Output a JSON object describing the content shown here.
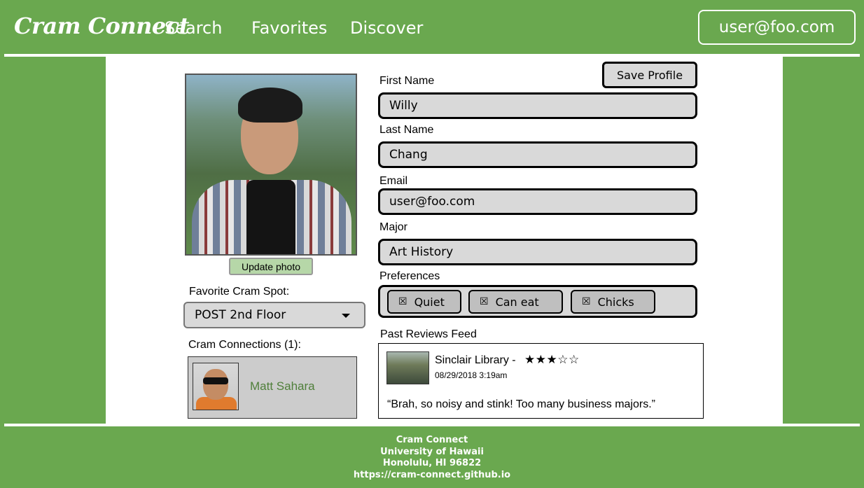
{
  "header": {
    "logo": "Cram Connect",
    "nav": [
      "Search",
      "Favorites",
      "Discover"
    ],
    "user": "user@foo.com"
  },
  "profile": {
    "update_photo": "Update photo",
    "save_label": "Save Profile",
    "fields": {
      "first_name": {
        "label": "First Name",
        "value": "Willy"
      },
      "last_name": {
        "label": "Last Name",
        "value": "Chang"
      },
      "email": {
        "label": "Email",
        "value": "user@foo.com"
      },
      "major": {
        "label": "Major",
        "value": "Art History"
      }
    },
    "preferences": {
      "label": "Preferences",
      "items": [
        "Quiet",
        "Can eat",
        "Chicks"
      ]
    },
    "favorite_spot": {
      "label": "Favorite Cram Spot:",
      "value": "POST 2nd Floor"
    },
    "connections": {
      "label": "Cram Connections (1):",
      "items": [
        {
          "name": "Matt Sahara"
        }
      ]
    },
    "reviews": {
      "label": "Past Reviews Feed",
      "items": [
        {
          "place": "Sinclair Library -",
          "stars": "★★★☆☆",
          "rating": 3,
          "date": "08/29/2018 3:19am",
          "text": "“Brah, so noisy and stink! Too many business majors.”"
        }
      ]
    }
  },
  "footer": {
    "lines": [
      "Cram Connect",
      "University of Hawaii",
      "Honolulu, HI 96822",
      "https://cram-connect.github.io"
    ]
  },
  "colors": {
    "brand_green": "#6aa84f",
    "field_gray": "#d9d9d9",
    "update_button": "#b6d7a8",
    "connection_name": "#4f7f3a"
  }
}
